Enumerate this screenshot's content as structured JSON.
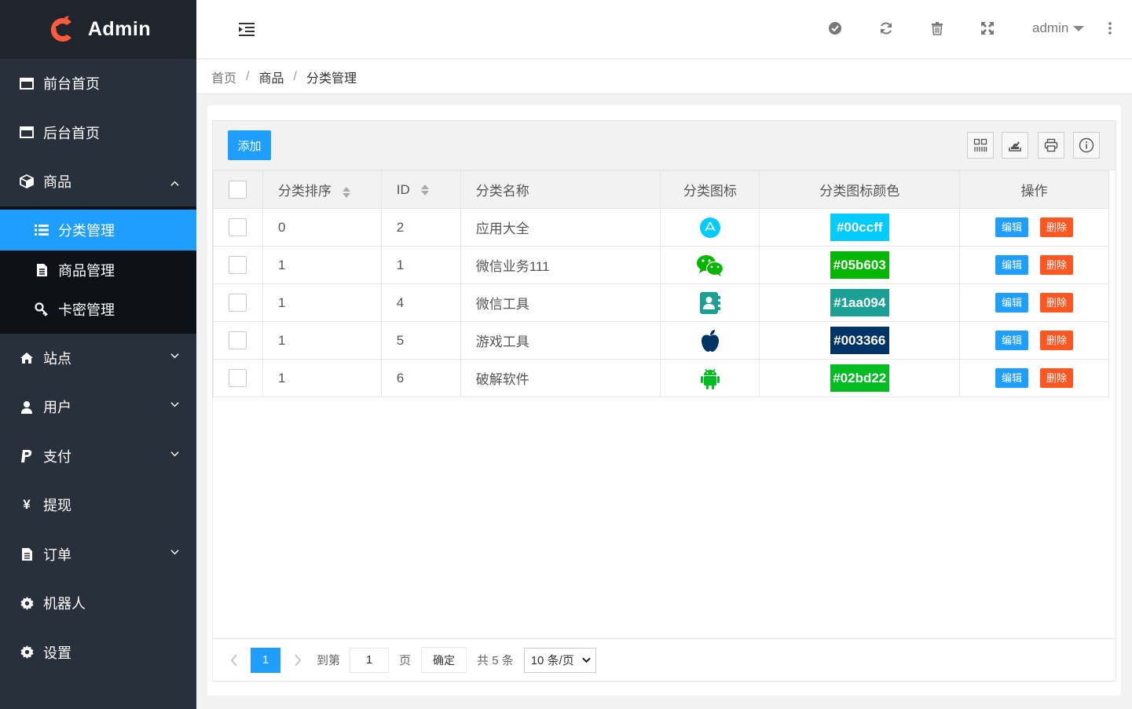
{
  "app": {
    "title": "Admin",
    "brand_color": "#ff5a3c"
  },
  "sidebar": {
    "items": [
      {
        "label": "前台首页",
        "icon": "window-icon"
      },
      {
        "label": "后台首页",
        "icon": "window-icon"
      },
      {
        "label": "商品",
        "icon": "cube-icon",
        "expanded": true,
        "children": [
          {
            "label": "分类管理",
            "icon": "list-icon",
            "active": true
          },
          {
            "label": "商品管理",
            "icon": "file-icon"
          },
          {
            "label": "卡密管理",
            "icon": "key-icon"
          }
        ]
      },
      {
        "label": "站点",
        "icon": "home-icon"
      },
      {
        "label": "用户",
        "icon": "user-icon"
      },
      {
        "label": "支付",
        "icon": "paypal-icon"
      },
      {
        "label": "提现",
        "icon": "yen-icon"
      },
      {
        "label": "订单",
        "icon": "file-icon"
      },
      {
        "label": "机器人",
        "icon": "gear-icon"
      },
      {
        "label": "设置",
        "icon": "gear-icon"
      }
    ],
    "yen_glyph": "¥"
  },
  "header": {
    "user": "admin"
  },
  "breadcrumb": {
    "home": "首页",
    "section": "商品",
    "current": "分类管理",
    "sep": "/"
  },
  "toolbar": {
    "add_label": "添加"
  },
  "table": {
    "headers": [
      "分类排序",
      "ID",
      "分类名称",
      "分类图标",
      "分类图标颜色",
      "操作"
    ],
    "rows": [
      {
        "sort": "0",
        "id": "2",
        "name": "应用大全",
        "icon": "appstore-icon",
        "color": "#00ccff",
        "color_label": "#00ccff"
      },
      {
        "sort": "1",
        "id": "1",
        "name": "微信业务111",
        "icon": "wechat-icon",
        "color": "#05b603",
        "color_label": "#05b603"
      },
      {
        "sort": "1",
        "id": "4",
        "name": "微信工具",
        "icon": "contact-book-icon",
        "color": "#1aa094",
        "color_label": "#1aa094"
      },
      {
        "sort": "1",
        "id": "5",
        "name": "游戏工具",
        "icon": "apple-icon",
        "color": "#003366",
        "color_label": "#003366"
      },
      {
        "sort": "1",
        "id": "6",
        "name": "破解软件",
        "icon": "android-icon",
        "color": "#02bd22",
        "color_label": "#02bd22"
      }
    ],
    "edit_label": "编辑",
    "delete_label": "删除"
  },
  "pager": {
    "current": "1",
    "goto_label": "到第",
    "goto_value": "1",
    "page_unit": "页",
    "confirm": "确定",
    "total": "共 5 条",
    "per_page": "10 条/页"
  },
  "colors": {
    "primary": "#1e9fff",
    "danger": "#ff5722",
    "sidebar_bg": "#28303b"
  }
}
